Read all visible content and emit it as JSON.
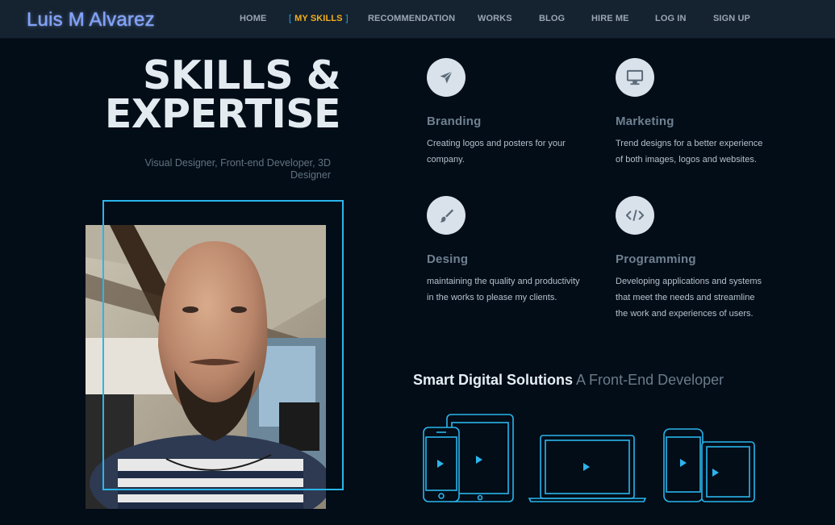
{
  "brand": "Luis M Alvarez",
  "nav": [
    {
      "label": "HOME",
      "active": false
    },
    {
      "label": "MY SKILLS",
      "active": true
    },
    {
      "label": "RECOMMENDATION",
      "active": false
    },
    {
      "label": "WORKS",
      "active": false
    },
    {
      "label": "BLOG",
      "active": false
    },
    {
      "label": "HIRE ME",
      "active": false
    },
    {
      "label": "LOG IN",
      "active": false
    },
    {
      "label": "SIGN UP",
      "active": false
    }
  ],
  "hero": {
    "title_line1": "SKILLS &",
    "title_line2": "EXPERTISE",
    "subtitle": "Visual Designer, Front-end Developer, 3D Designer"
  },
  "skills": [
    {
      "icon": "paper-plane-icon",
      "title": "Branding",
      "text": "Creating logos and posters for your company."
    },
    {
      "icon": "monitor-icon",
      "title": "Marketing",
      "text": "Trend designs for a better experience of both images, logos and websites."
    },
    {
      "icon": "brush-icon",
      "title": "Desing",
      "text": "maintaining the quality and productivity in the works to please my clients."
    },
    {
      "icon": "code-icon",
      "title": "Programming",
      "text": "Developing applications and systems that meet the needs and streamline the work and experiences of users."
    }
  ],
  "solutions": {
    "strong": "Smart Digital Solutions",
    "light": "A Front-End Developer"
  },
  "colors": {
    "accent": "#2bb5ec",
    "active_nav": "#f2b01e",
    "background": "#020d18"
  }
}
